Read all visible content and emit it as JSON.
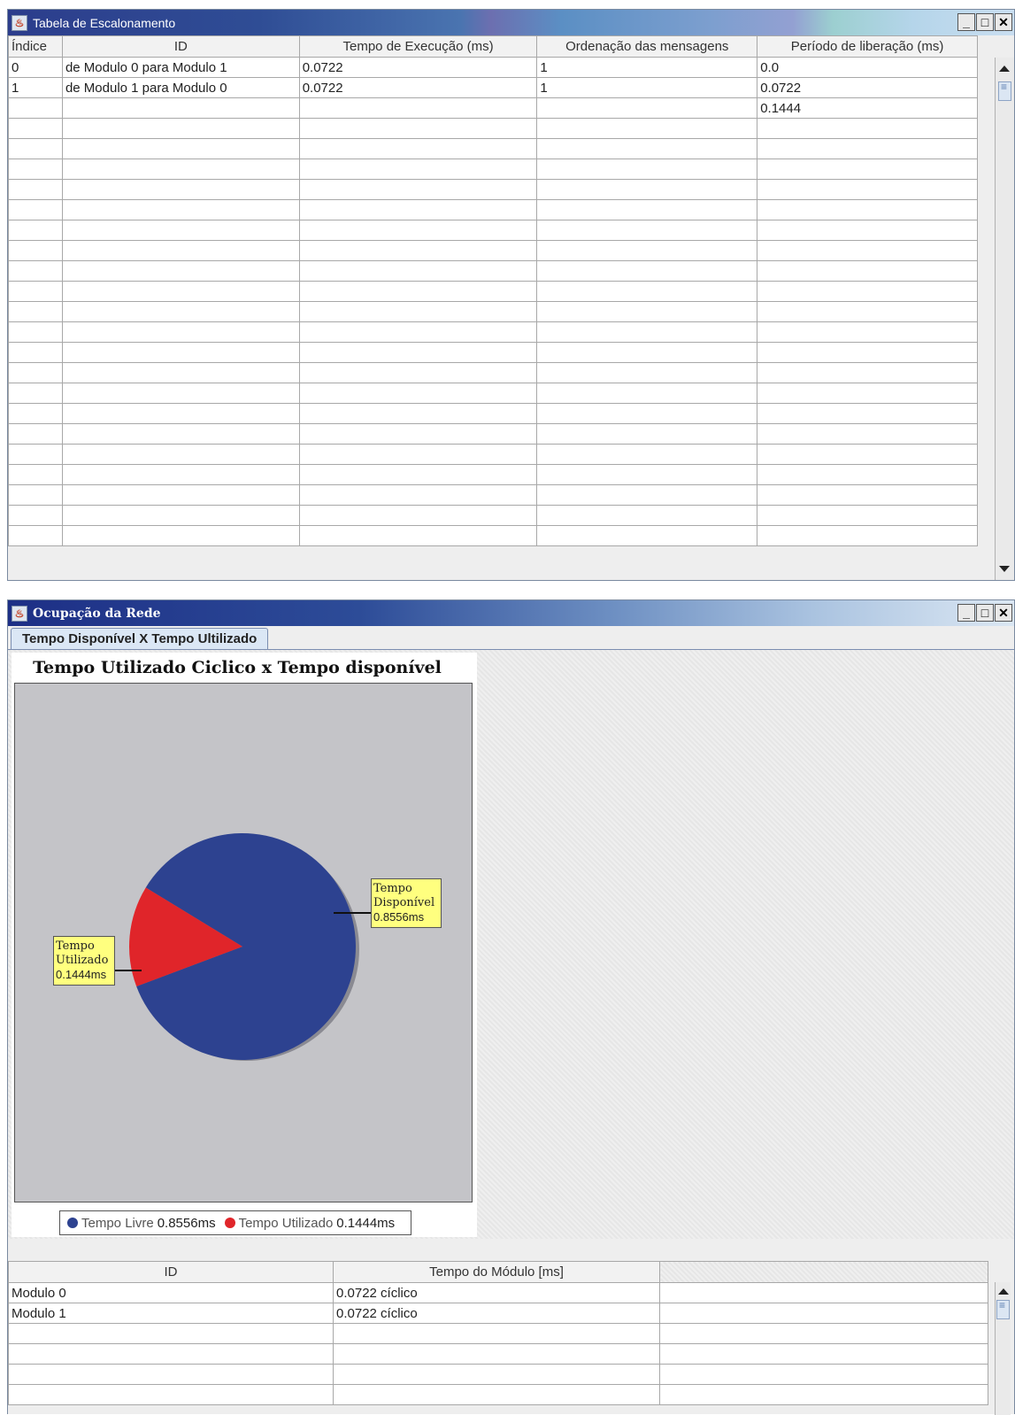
{
  "schedule_window": {
    "title": "Tabela de Escalonamento",
    "columns": [
      "Índice",
      "ID",
      "Tempo de Execução (ms)",
      "Ordenação das mensagens",
      "Período de liberação (ms)"
    ],
    "rows": [
      [
        "0",
        "de Modulo 0 para Modulo 1",
        "0.0722",
        "1",
        "0.0"
      ],
      [
        "1",
        "de Modulo 1 para Modulo 0",
        "0.0722",
        "1",
        "0.0722"
      ],
      [
        "",
        "",
        "",
        "",
        "0.1444"
      ]
    ]
  },
  "network_window": {
    "title": "Ocupação da Rede",
    "tab_label": "Tempo Disponível X Tempo Ultilizado",
    "chart_title": "Tempo Utilizado Ciclico x Tempo disponível",
    "label_available": [
      "Tempo",
      "Disponível",
      "0.8556ms"
    ],
    "label_used": [
      "Tempo",
      "Utilizado",
      "0.1444ms"
    ],
    "legend": {
      "free_name": "Tempo Livre",
      "free_value": "0.8556ms",
      "used_name": "Tempo Utilizado",
      "used_value": "0.1444ms"
    },
    "module_table": {
      "columns": [
        "ID",
        "Tempo do Módulo [ms]"
      ],
      "rows": [
        [
          "Modulo 0",
          "0.0722 cíclico"
        ],
        [
          "Modulo 1",
          "0.0722 cíclico"
        ]
      ]
    }
  },
  "chart_data": {
    "type": "pie",
    "title": "Tempo Utilizado Ciclico x Tempo disponível",
    "categories": [
      "Tempo Livre",
      "Tempo Utilizado"
    ],
    "values": [
      0.8556,
      0.1444
    ],
    "colors": [
      "#2d4290",
      "#e0252a"
    ],
    "legend_position": "bottom"
  },
  "colors": {
    "pie_free": "#2d4290",
    "pie_used": "#e0252a",
    "label_bg": "#ffff7f",
    "plot_bg": "#c4c4c8"
  },
  "icons": {
    "window_icon": "java-cup-icon",
    "minimize": "minimize-icon",
    "maximize": "maximize-icon",
    "close": "close-icon"
  }
}
